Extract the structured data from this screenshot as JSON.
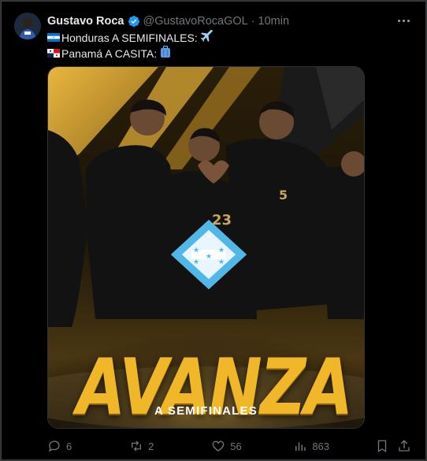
{
  "tweet": {
    "author_name": "Gustavo Roca",
    "handle": "@GustavoRocaGOL",
    "separator": "·",
    "time": "10min",
    "lines": [
      {
        "flag": "honduras",
        "text": "Honduras A SEMIFINALES:",
        "emoji": "airplane"
      },
      {
        "flag": "panama",
        "text": "Panamá A CASITA:",
        "emoji": "luggage"
      }
    ],
    "line1_text": "Honduras A SEMIFINALES:",
    "line2_text": "Panamá A CASITA:"
  },
  "media": {
    "headline": "AVANZA",
    "subheadline": "A SEMIFINALES",
    "jersey_numbers": [
      "23",
      "5"
    ]
  },
  "actions": {
    "replies": "6",
    "reposts": "2",
    "likes": "56",
    "views": "863"
  },
  "colors": {
    "background": "#000000",
    "text_primary": "#e7e9ea",
    "text_secondary": "#71767b",
    "verified": "#1d9bf0",
    "gold": "#f0b828"
  }
}
